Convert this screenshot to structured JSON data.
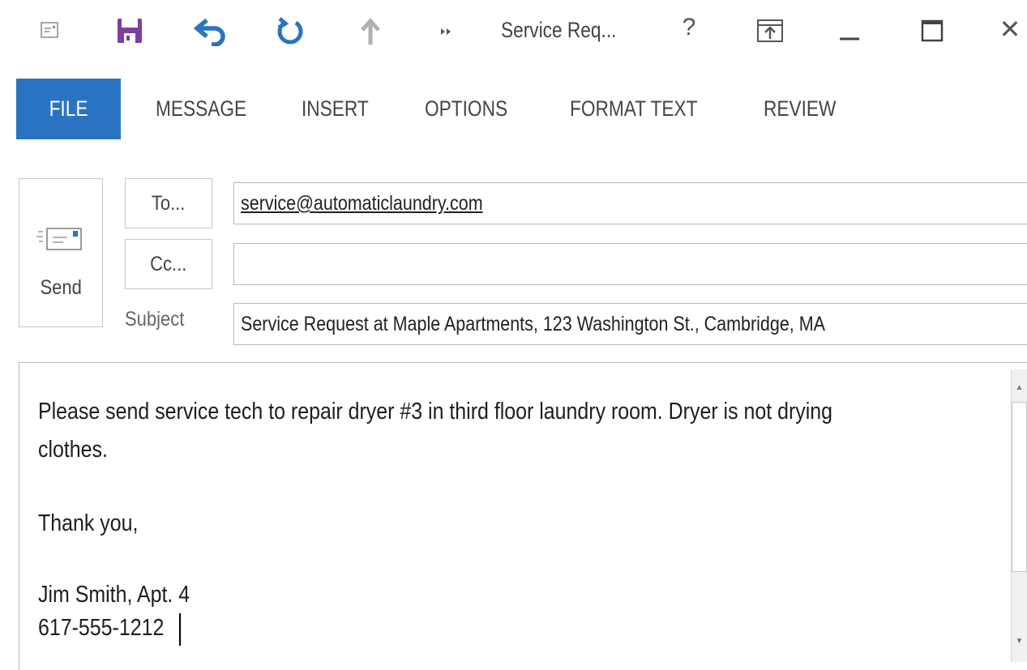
{
  "window": {
    "title": "Service Req...",
    "controls": {
      "help": "?",
      "close": "✕"
    },
    "icons": [
      "outlook-app-icon",
      "save-icon",
      "undo-icon",
      "redo-icon",
      "previous-item-icon",
      "more-commands-icon",
      "ribbon-display-options-icon",
      "minimize-icon",
      "maximize-icon"
    ]
  },
  "ribbon": {
    "tabs": [
      "FILE",
      "MESSAGE",
      "INSERT",
      "OPTIONS",
      "FORMAT TEXT",
      "REVIEW"
    ],
    "active_tab": "FILE",
    "active_color": "#2a73c1"
  },
  "compose": {
    "send_label": "Send",
    "to_button": "To...",
    "cc_button": "Cc...",
    "subject_label": "Subject",
    "to_value": "service@automaticlaundry.com",
    "cc_value": "",
    "subject_value": "Service Request at Maple Apartments, 123 Washington St., Cambridge, MA"
  },
  "message": {
    "lines": [
      "Please send service tech to repair dryer #3 in third floor laundry room. Dryer is not drying",
      "clothes.",
      "Thank you,",
      "Jim Smith, Apt. 4",
      "617-555-1212"
    ]
  },
  "colors": {
    "save_icon": "#7b3fa0",
    "undo_redo_icons": "#2a73c1"
  }
}
